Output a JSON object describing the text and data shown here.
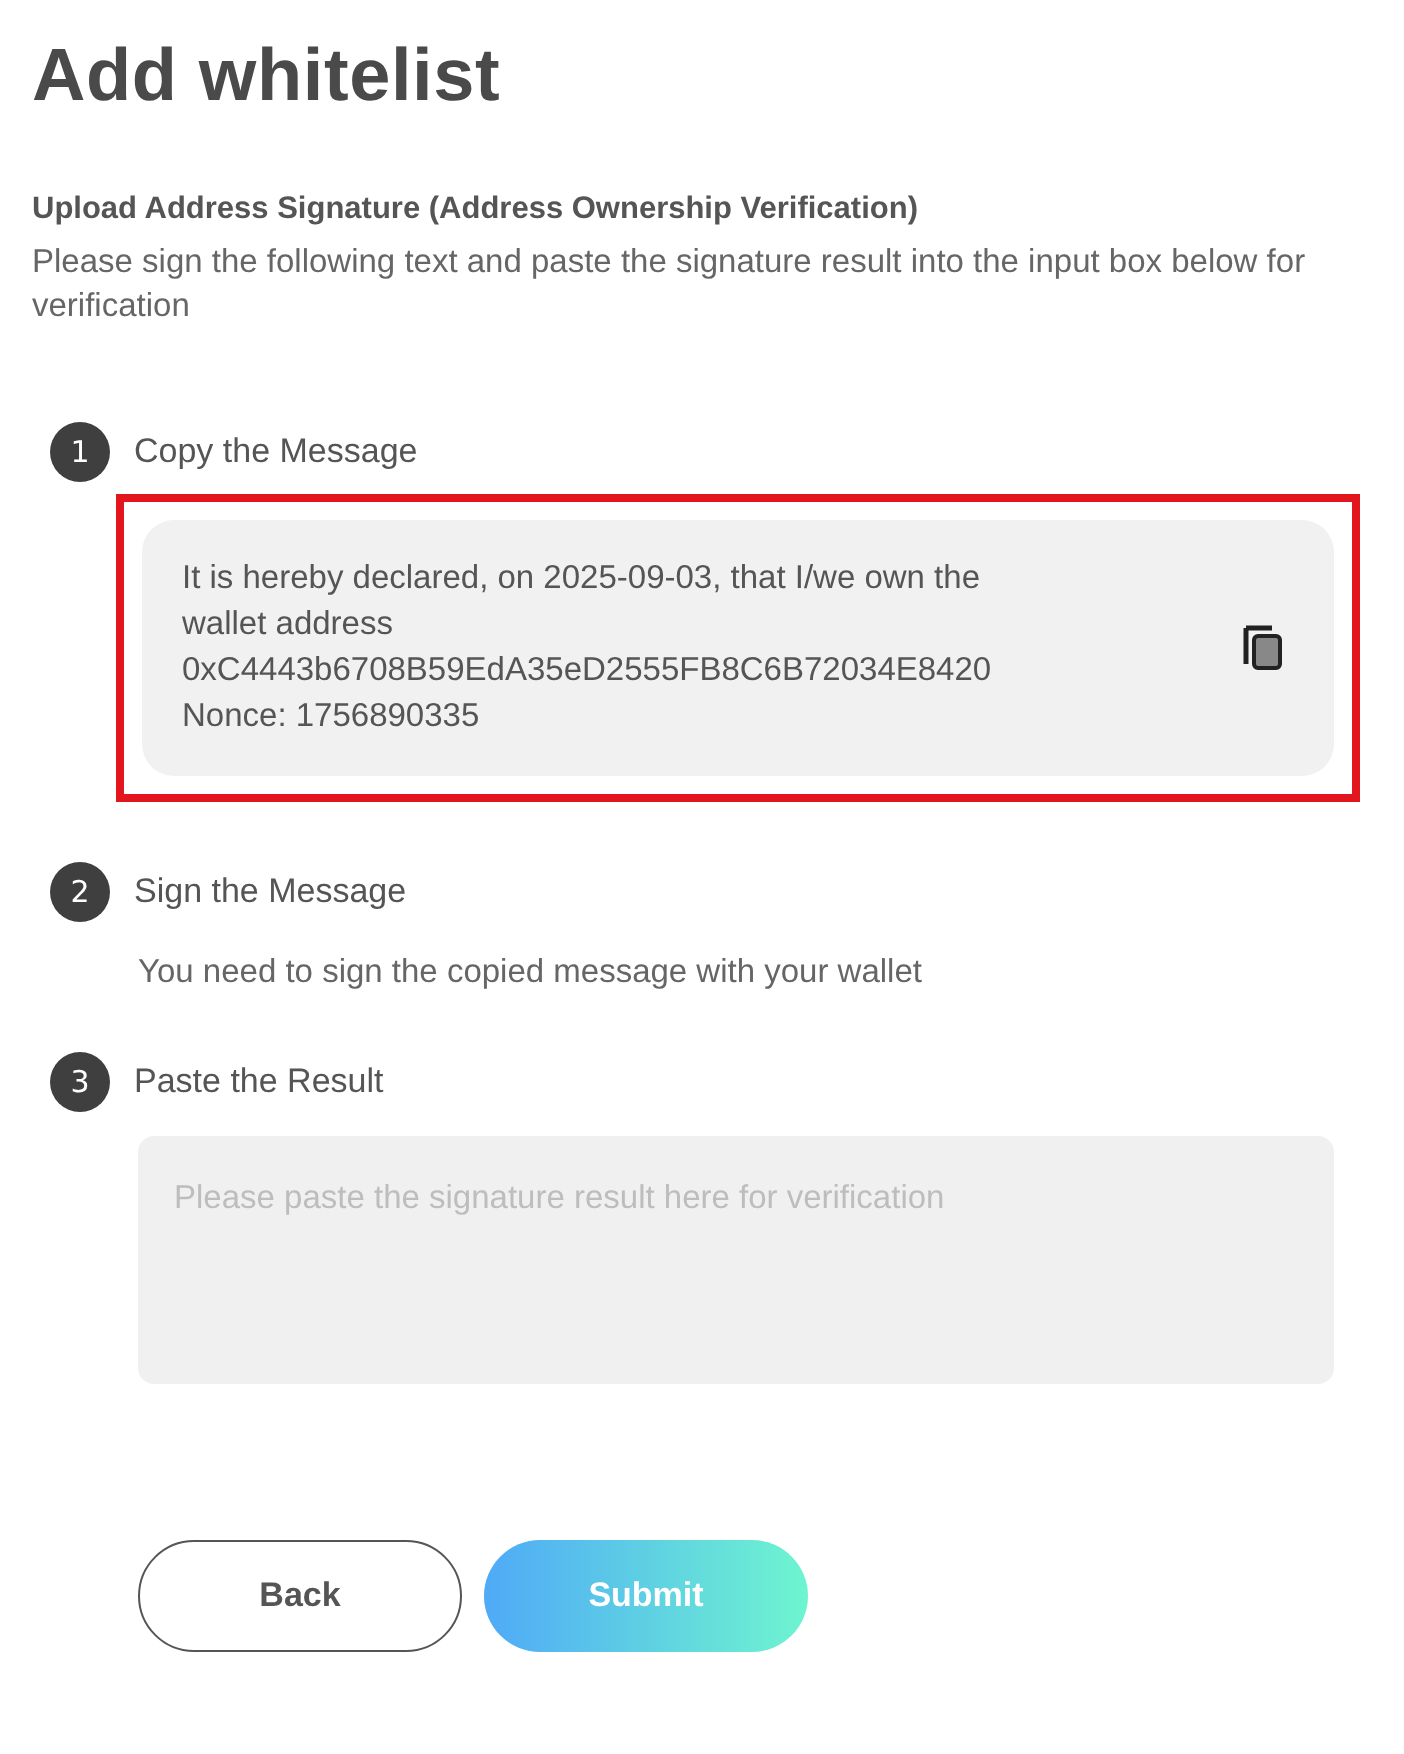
{
  "title": "Add whitelist",
  "subtitle": "Upload Address Signature (Address Ownership Verification)",
  "description": "Please sign the following text and paste the signature result into the input box below for verification",
  "steps": [
    {
      "number": "1",
      "label": "Copy the Message",
      "kind": "message",
      "highlighted": true,
      "lines": [
        "It is hereby declared, on 2025-09-03, that I/we own the",
        "wallet address",
        "0xC4443b6708B59EdA35eD2555FB8C6B72034E8420",
        "Nonce: 1756890335"
      ]
    },
    {
      "number": "2",
      "label": "Sign the Message",
      "kind": "note",
      "text": "You need to sign the copied message with your wallet"
    },
    {
      "number": "3",
      "label": "Paste the Result",
      "kind": "field",
      "placeholder": "Please paste the signature result here for verification"
    }
  ],
  "buttons": [
    {
      "label": "Back",
      "kind": "outline"
    },
    {
      "label": "Submit",
      "kind": "gradient"
    }
  ]
}
